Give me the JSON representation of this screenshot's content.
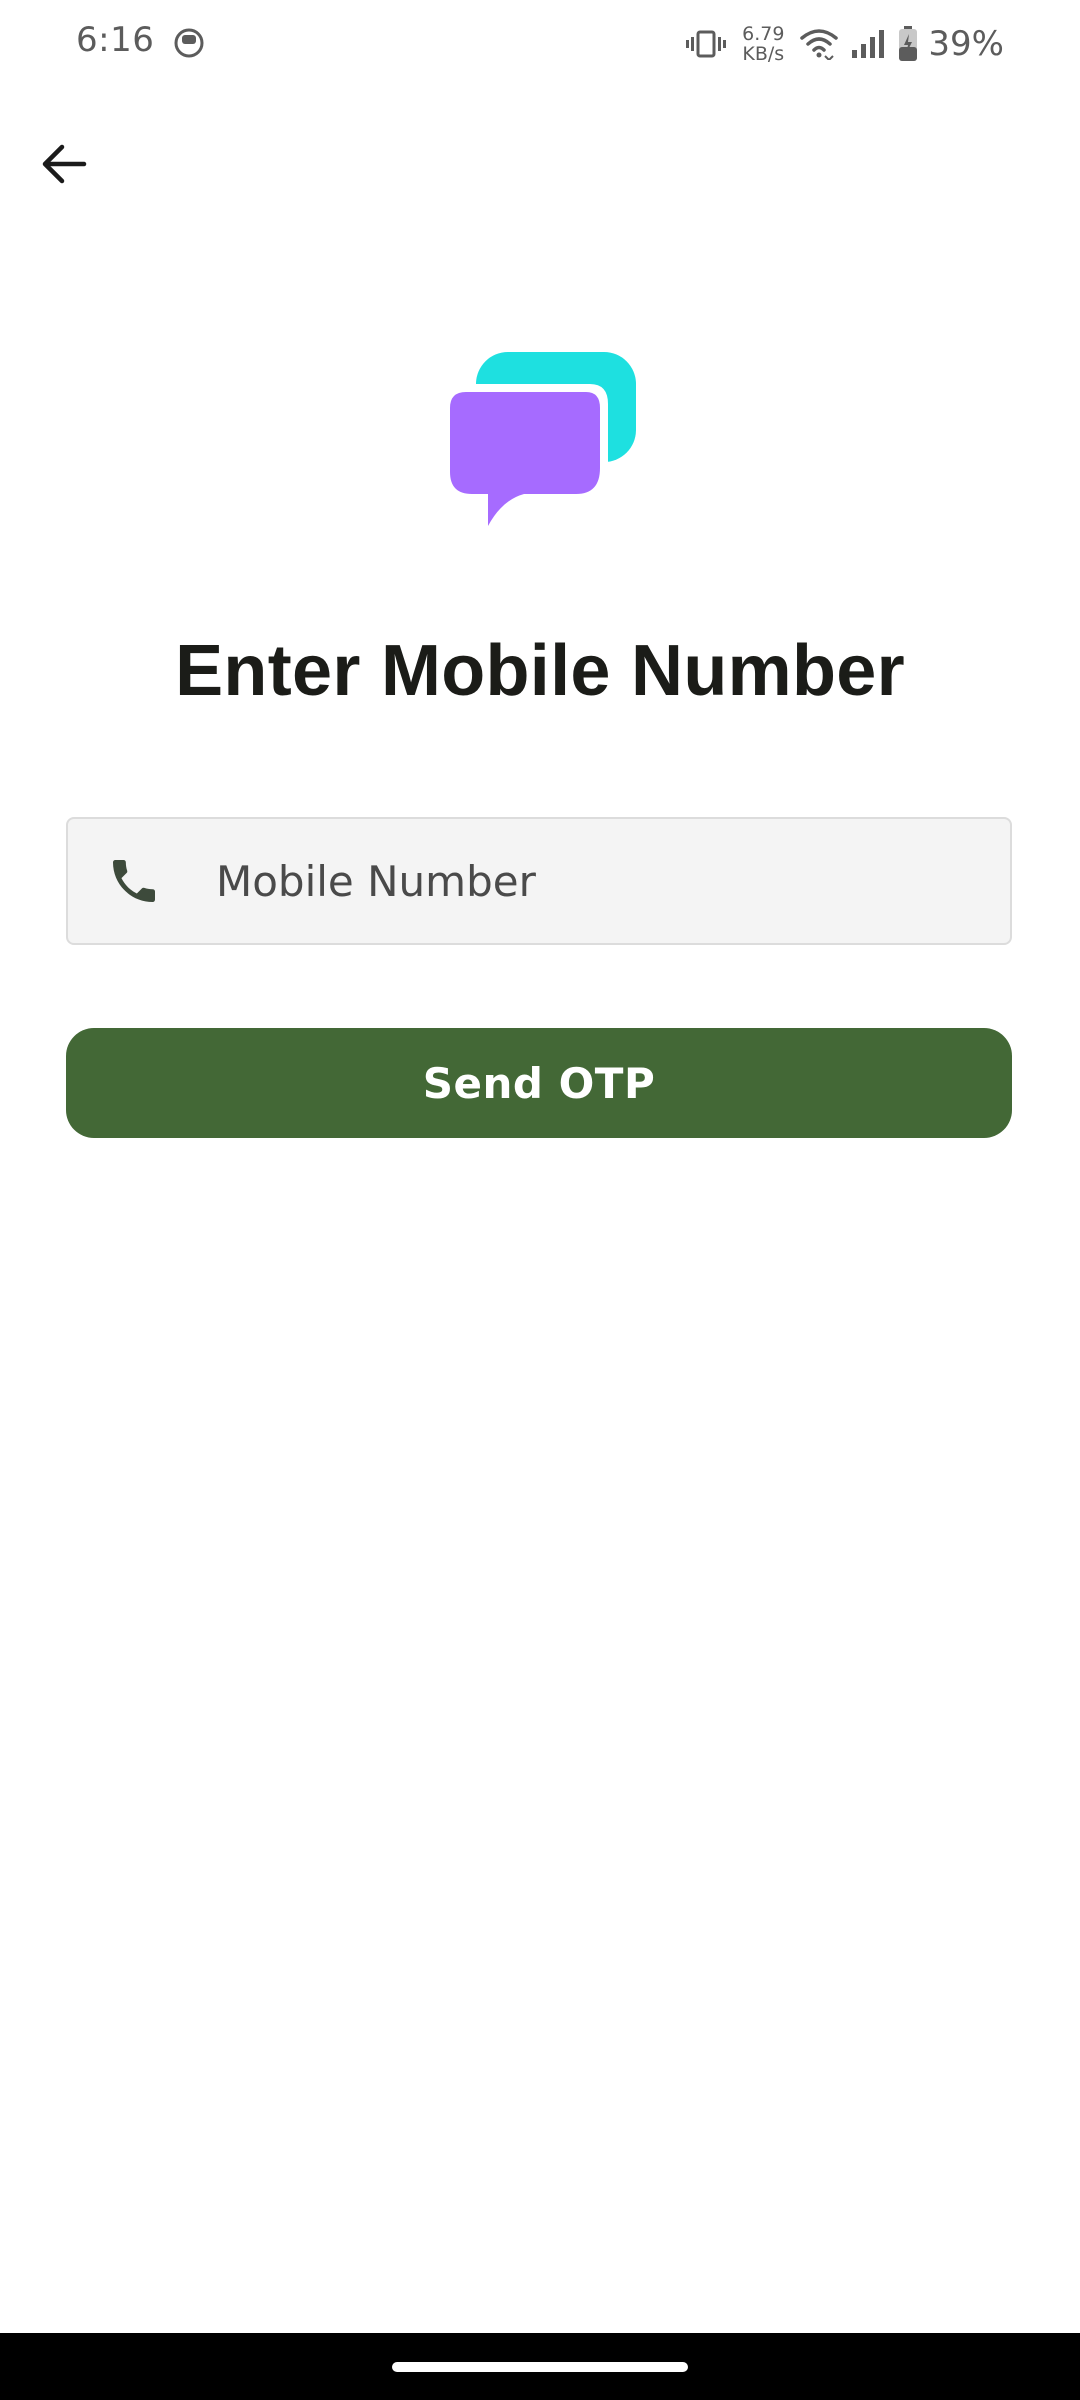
{
  "status_bar": {
    "time": "6:16",
    "net_speed_value": "6.79",
    "net_speed_unit": "KB/s",
    "battery_percent": "39%",
    "icons": [
      "notification-app-icon",
      "vibrate-icon",
      "wifi-icon",
      "cellular-signal-icon",
      "battery-charging-icon"
    ]
  },
  "header": {
    "back_icon": "arrow-left-icon"
  },
  "logo": {
    "icon": "chat-bubbles-logo",
    "colors": {
      "back_bubble": "#1ee0e0",
      "front_bubble": "#a66bff"
    }
  },
  "main": {
    "title": "Enter Mobile Number",
    "mobile_field": {
      "icon": "phone-icon",
      "placeholder": "Mobile Number",
      "value": ""
    },
    "send_button_label": "Send OTP"
  },
  "colors": {
    "primary_button": "#436836",
    "title_text": "#1b1c18",
    "field_background": "#f4f4f4"
  }
}
